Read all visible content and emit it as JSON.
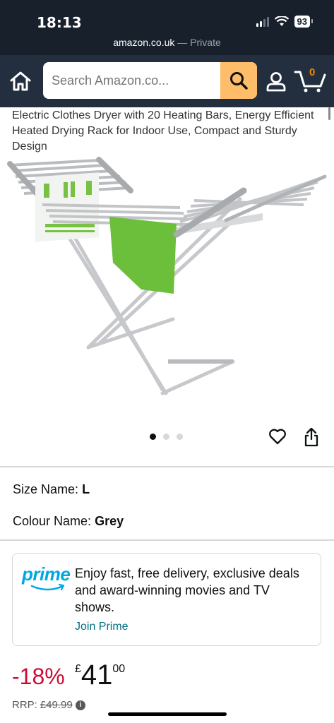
{
  "status_bar": {
    "time": "18:13",
    "battery": "93",
    "url": "amazon.co.uk",
    "private_label": " — Private"
  },
  "header": {
    "search_placeholder": "Search Amazon.co...",
    "cart_count": "0",
    "brand_color": "#232f3e",
    "search_button_color": "#febd69"
  },
  "product": {
    "title": "Electric Clothes Dryer with 20 Heating Bars, Energy Efficient Heated Drying Rack for Indoor Use, Compact and Sturdy Design",
    "image_alt": "heated-clothes-airer-image",
    "image_count": 3,
    "active_image": 0
  },
  "variations": {
    "size_label": "Size Name:",
    "size_value": "L",
    "colour_label": "Colour Name:",
    "colour_value": "Grey"
  },
  "prime": {
    "logo_text": "prime",
    "message": "Enjoy fast, free delivery, exclusive deals and award-winning movies and TV shows.",
    "link": "Join Prime"
  },
  "pricing": {
    "discount": "-18%",
    "currency": "£",
    "whole": "41",
    "fraction": "00",
    "rrp_label": "RRP:",
    "rrp_value": "£49.99"
  }
}
